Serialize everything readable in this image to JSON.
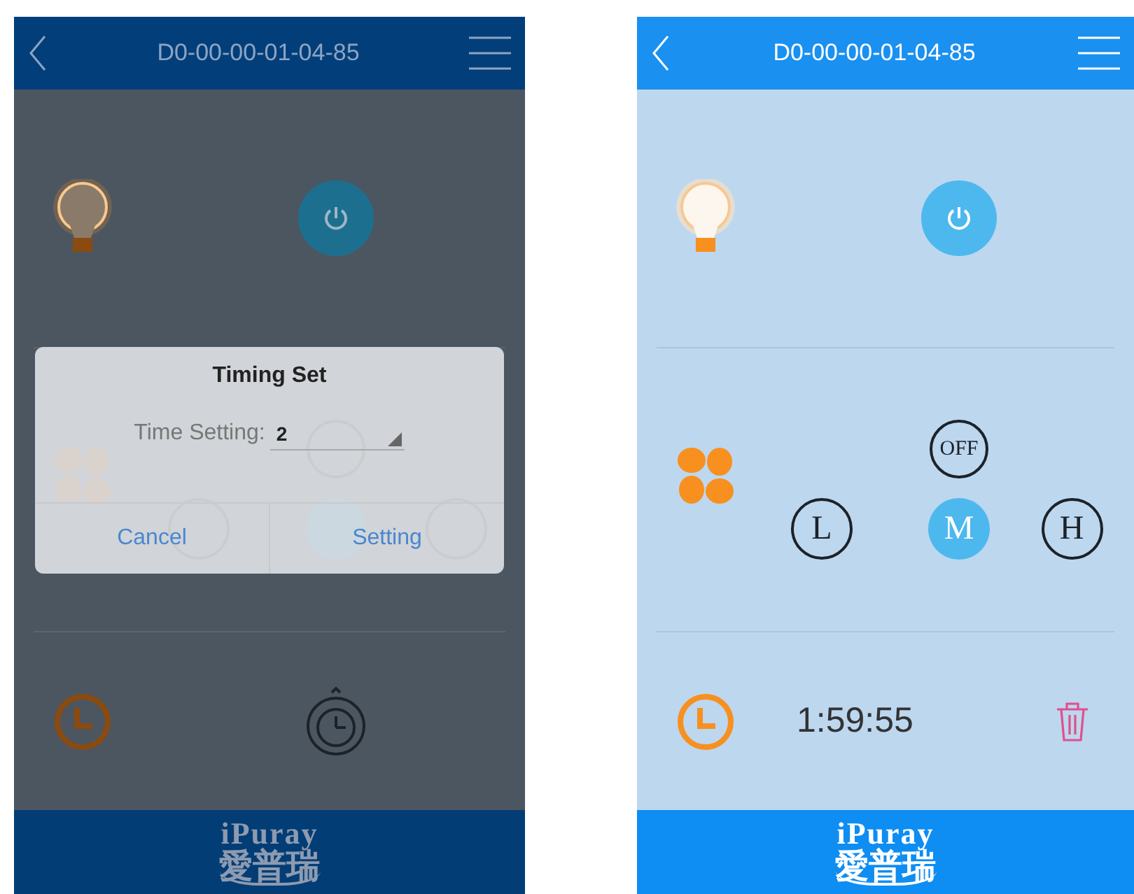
{
  "screens": [
    {
      "dimmed": true,
      "header": {
        "title": "D0-00-00-01-04-85"
      },
      "light": {
        "on": true
      },
      "power": {
        "on": true
      },
      "fan": {
        "speeds": [
          {
            "selected": false
          },
          {
            "selected": false
          },
          {
            "selected": true
          },
          {
            "selected": false
          }
        ]
      },
      "timer": {
        "running": false
      },
      "dialog": {
        "title": "Timing Set",
        "label": "Time Setting:",
        "value": "2",
        "buttons": [
          "Cancel",
          "Setting"
        ]
      },
      "footer": {
        "logo_top": "iPuray",
        "logo_bottom": "愛普瑞"
      }
    },
    {
      "dimmed": false,
      "header": {
        "title": "D0-00-00-01-04-85"
      },
      "light": {
        "on": true
      },
      "power": {
        "on": true
      },
      "fan": {
        "speeds": [
          {
            "label": "OFF",
            "selected": false
          },
          {
            "label": "L",
            "selected": false
          },
          {
            "label": "M",
            "selected": true
          },
          {
            "label": "H",
            "selected": false
          }
        ]
      },
      "timer": {
        "running": true,
        "time": "1:59:55"
      },
      "footer": {
        "logo_top": "iPuray",
        "logo_bottom": "愛普瑞"
      }
    }
  ]
}
